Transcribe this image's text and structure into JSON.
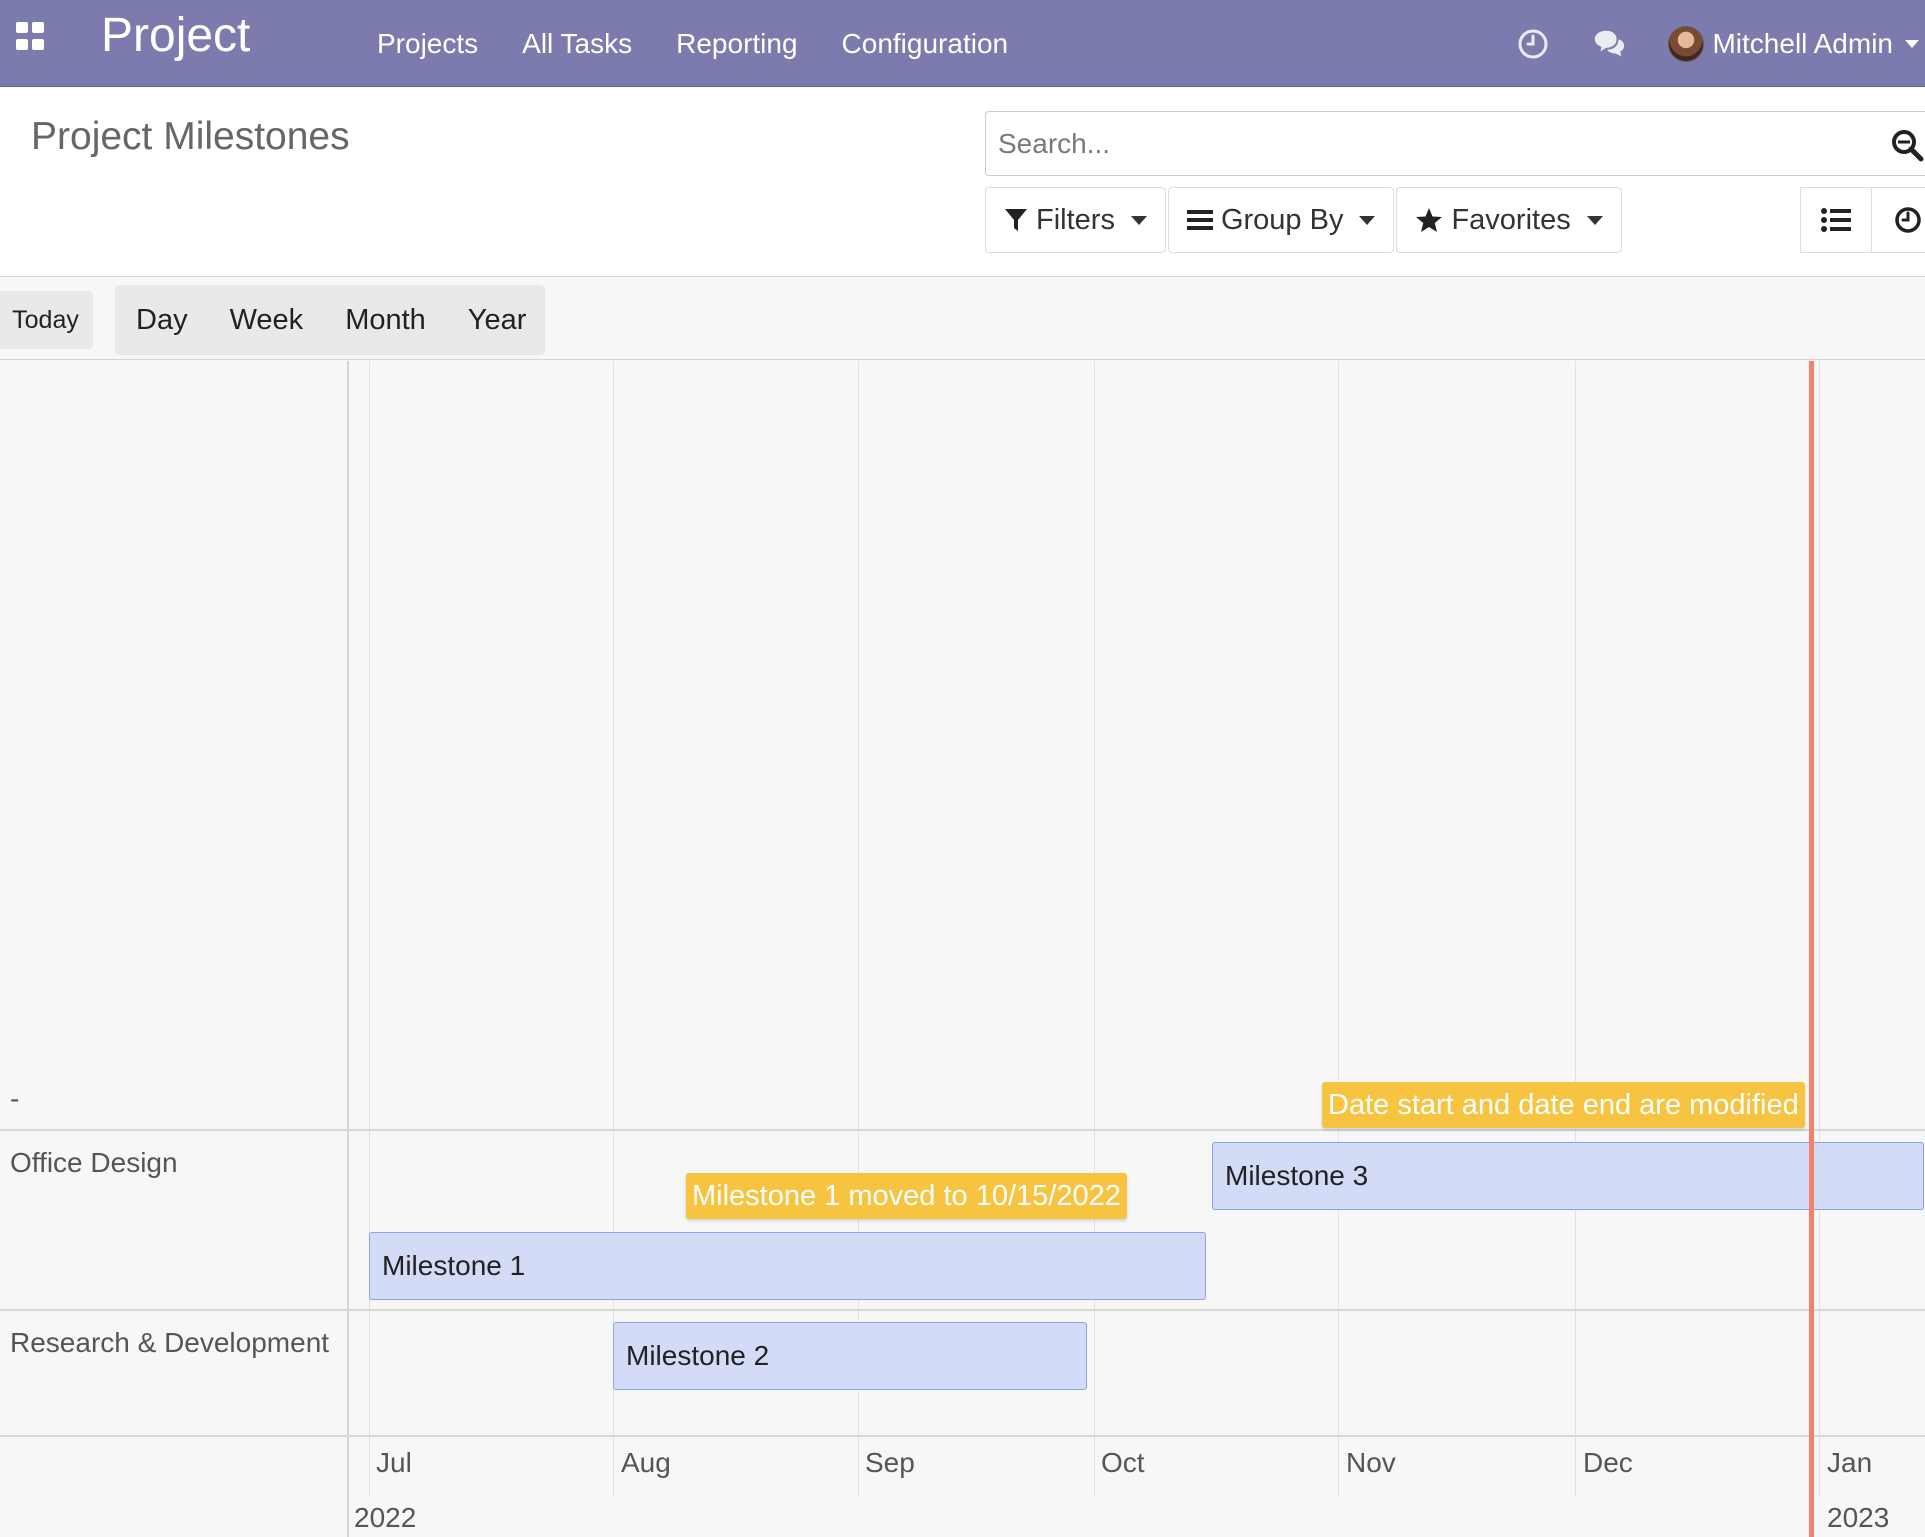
{
  "navbar": {
    "app_name": "Project",
    "menu": [
      "Projects",
      "All Tasks",
      "Reporting",
      "Configuration"
    ],
    "user_name": "Mitchell Admin",
    "icons": [
      "apps-grid-icon",
      "clock-icon",
      "chat-icon"
    ]
  },
  "control_panel": {
    "title": "Project Milestones",
    "search_placeholder": "Search...",
    "filters_label": "Filters",
    "group_by_label": "Group By",
    "favorites_label": "Favorites",
    "views": [
      "list-view-icon",
      "activity-view-icon"
    ]
  },
  "toolbar": {
    "today_label": "Today",
    "scales": [
      "Day",
      "Week",
      "Month",
      "Year"
    ]
  },
  "gantt": {
    "rows": [
      {
        "label": "-"
      },
      {
        "label": "Office Design"
      },
      {
        "label": "Research & Development"
      }
    ],
    "bars": [
      {
        "label": "Milestone 3",
        "row": "Office Design",
        "start": "2022-10-15",
        "end": "2022-12-31"
      },
      {
        "label": "Milestone 1",
        "row": "Office Design",
        "start": "2022-07-01",
        "end": "2022-10-15"
      },
      {
        "label": "Milestone 2",
        "row": "Research & Development",
        "start": "2022-08-01",
        "end": "2022-09-30"
      }
    ],
    "notifications": [
      "Date start and date end are modified",
      "Milestone 1 moved to 10/15/2022"
    ],
    "months": [
      "Jul",
      "Aug",
      "Sep",
      "Oct",
      "Nov",
      "Dec",
      "Jan"
    ],
    "years": [
      "2022",
      "2023"
    ],
    "colors": {
      "bar_fill": "#d4dbf7",
      "bar_border": "#8da2ea",
      "notification": "#f7c442",
      "today_line": "#f3826b",
      "navbar": "#7c7bad"
    }
  }
}
